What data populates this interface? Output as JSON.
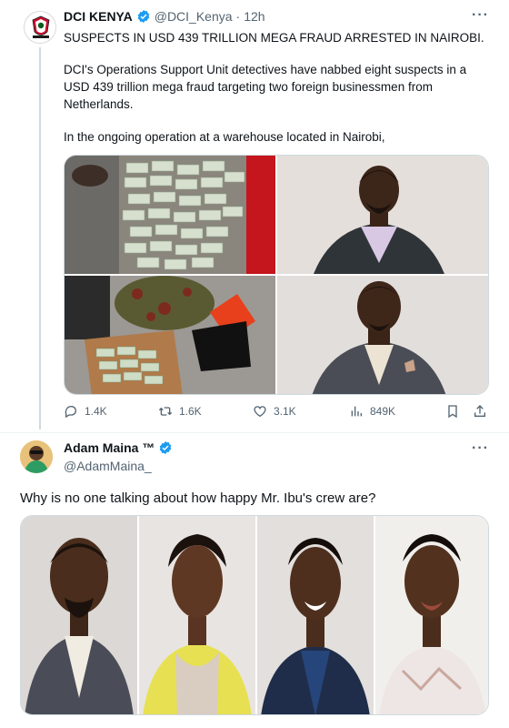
{
  "tweet1": {
    "author": "DCI KENYA",
    "handle": "@DCI_Kenya",
    "separator": "·",
    "time": "12h",
    "more": "···",
    "headline": "SUSPECTS IN USD 439 TRILLION MEGA FRAUD ARRESTED IN NAIROBI.",
    "paragraph1": "DCI's Operations Support Unit detectives have nabbed eight suspects in a USD 439 trillion mega fraud targeting two foreign businessmen from Netherlands.",
    "paragraph2": "In the ongoing operation at a warehouse located in Nairobi,",
    "stats": {
      "replies": "1.4K",
      "retweets": "1.6K",
      "likes": "3.1K",
      "views": "849K"
    }
  },
  "tweet2": {
    "author": "Adam Maina ™",
    "handle": "@AdamMaina_",
    "more": "···",
    "text": "Why is no one talking about how happy Mr. Ibu's crew are?"
  },
  "colors": {
    "verified": "#1d9bf0",
    "muted": "#536471",
    "border": "#cfd9de"
  },
  "icons": [
    "verified-badge-icon",
    "reply-icon",
    "retweet-icon",
    "like-icon",
    "views-icon",
    "bookmark-icon",
    "share-icon",
    "more-icon"
  ]
}
